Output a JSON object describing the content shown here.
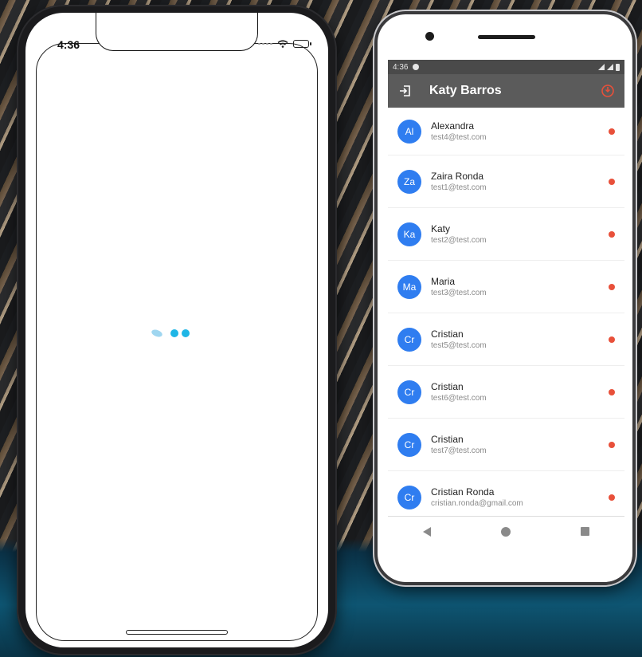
{
  "ios": {
    "time": "4:36"
  },
  "android": {
    "status_time": "4:36",
    "appbar": {
      "title": "Katy Barros",
      "login_icon": "login-icon",
      "power_icon": "power-icon"
    },
    "users": [
      {
        "initials": "Al",
        "name": "Alexandra",
        "email": "test4@test.com"
      },
      {
        "initials": "Za",
        "name": "Zaira Ronda",
        "email": "test1@test.com"
      },
      {
        "initials": "Ka",
        "name": "Katy",
        "email": "test2@test.com"
      },
      {
        "initials": "Ma",
        "name": "Maria",
        "email": "test3@test.com"
      },
      {
        "initials": "Cr",
        "name": "Cristian",
        "email": "test5@test.com"
      },
      {
        "initials": "Cr",
        "name": "Cristian",
        "email": "test6@test.com"
      },
      {
        "initials": "Cr",
        "name": "Cristian",
        "email": "test7@test.com"
      },
      {
        "initials": "Cr",
        "name": "Cristian Ronda",
        "email": "cristian.ronda@gmail.com"
      }
    ],
    "colors": {
      "appbar": "#5b5b5b",
      "avatar": "#2f7df0",
      "status_offline": "#e8503a",
      "loader": "#1fb6e6"
    }
  }
}
